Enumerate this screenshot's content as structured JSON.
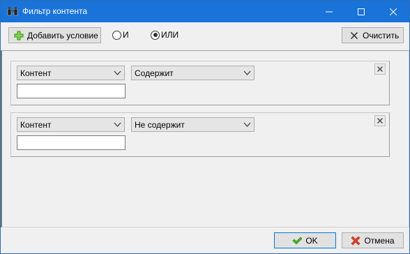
{
  "window": {
    "title": "Фильтр контента"
  },
  "toolbar": {
    "add_condition_label": "Добавить условие",
    "radio_and_label": "И",
    "radio_or_label": "ИЛИ",
    "selected_logic": "ИЛИ",
    "clear_label": "Очистить"
  },
  "conditions": [
    {
      "field": "Контент",
      "operator": "Содержит",
      "value": ""
    },
    {
      "field": "Контент",
      "operator": "Не содержит",
      "value": ""
    }
  ],
  "footer": {
    "ok_label": "OK",
    "cancel_label": "Отмена"
  },
  "colors": {
    "titlebar": "#1a73d8",
    "add_icon": "#4caf1e",
    "ok_icon": "#3cae1e",
    "cancel_icon": "#e0402b"
  }
}
